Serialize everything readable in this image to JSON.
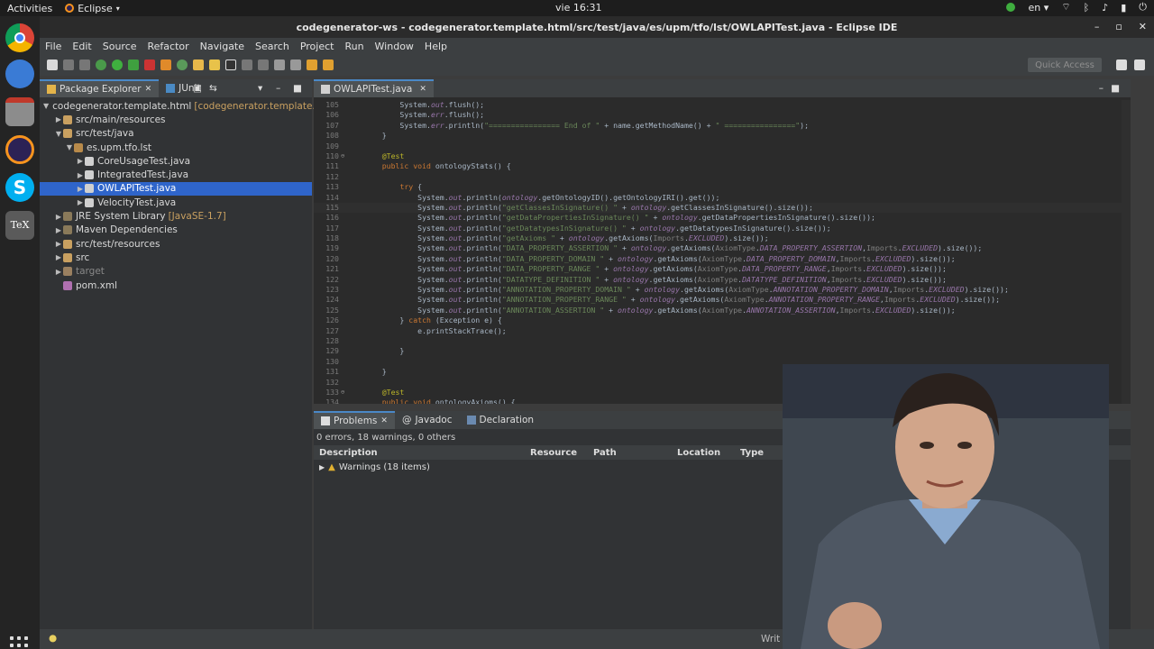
{
  "topbar": {
    "activities": "Activities",
    "app": "Eclipse",
    "clock": "vie 16:31",
    "lang": "en"
  },
  "titlebar": {
    "title": "codegenerator-ws - codegenerator.template.html/src/test/java/es/upm/tfo/lst/OWLAPITest.java - Eclipse IDE"
  },
  "menu": [
    "File",
    "Edit",
    "Source",
    "Refactor",
    "Navigate",
    "Search",
    "Project",
    "Run",
    "Window",
    "Help"
  ],
  "toolbar": {
    "quick_access": "Quick Access"
  },
  "package_explorer": {
    "tab_label": "Package Explorer",
    "junit_label": "JUnit",
    "items": [
      {
        "label": "codegenerator.template.html",
        "deco": "[codegenerator.template.html",
        "indent": 0
      },
      {
        "label": "src/main/resources",
        "indent": 1
      },
      {
        "label": "src/test/java",
        "indent": 1
      },
      {
        "label": "es.upm.tfo.lst",
        "indent": 2
      },
      {
        "label": "CoreUsageTest.java",
        "indent": 3
      },
      {
        "label": "IntegratedTest.java",
        "indent": 3
      },
      {
        "label": "OWLAPITest.java",
        "indent": 3,
        "selected": true
      },
      {
        "label": "VelocityTest.java",
        "indent": 3
      },
      {
        "label": "JRE System Library",
        "deco": "[JavaSE-1.7]",
        "indent": 1
      },
      {
        "label": "Maven Dependencies",
        "indent": 1
      },
      {
        "label": "src/test/resources",
        "indent": 1
      },
      {
        "label": "src",
        "indent": 1
      },
      {
        "label": "target",
        "indent": 1,
        "dim": true
      },
      {
        "label": "pom.xml",
        "indent": 1
      }
    ]
  },
  "editor": {
    "tab_label": "OWLAPITest.java",
    "lines": [
      {
        "n": "105",
        "code": "        System.out.flush();"
      },
      {
        "n": "106",
        "code": "        System.err.flush();"
      },
      {
        "n": "107",
        "code": "        System.err.println(\"================ End of \" + name.getMethodName() + \" ================\");"
      },
      {
        "n": "108",
        "code": "    }"
      },
      {
        "n": "109",
        "code": ""
      },
      {
        "n": "110",
        "code": "    @Test"
      },
      {
        "n": "111",
        "code": "    public void ontologyStats() {"
      },
      {
        "n": "112",
        "code": ""
      },
      {
        "n": "113",
        "code": "        try {"
      },
      {
        "n": "114",
        "code": "            System.out.println(ontology.getOntologyID().getOntologyIRI().get());"
      },
      {
        "n": "115",
        "code": "            System.out.println(\"getClassesInSignature() \" + ontology.getClassesInSignature().size());"
      },
      {
        "n": "116",
        "code": "            System.out.println(\"getDataPropertiesInSignature() \" + ontology.getDataPropertiesInSignature().size());"
      },
      {
        "n": "117",
        "code": "            System.out.println(\"getDatatypesInSignature() \" + ontology.getDatatypesInSignature().size());"
      },
      {
        "n": "118",
        "code": "            System.out.println(\"getAxioms \" + ontology.getAxioms(Imports.EXCLUDED).size());"
      },
      {
        "n": "119",
        "code": "            System.out.println(\"DATA_PROPERTY_ASSERTION \" + ontology.getAxioms(AxiomType.DATA_PROPERTY_ASSERTION,Imports.EXCLUDED).size());"
      },
      {
        "n": "120",
        "code": "            System.out.println(\"DATA_PROPERTY_DOMAIN \" + ontology.getAxioms(AxiomType.DATA_PROPERTY_DOMAIN,Imports.EXCLUDED).size());"
      },
      {
        "n": "121",
        "code": "            System.out.println(\"DATA_PROPERTY_RANGE \" + ontology.getAxioms(AxiomType.DATA_PROPERTY_RANGE,Imports.EXCLUDED).size());"
      },
      {
        "n": "122",
        "code": "            System.out.println(\"DATATYPE_DEFINITION \" + ontology.getAxioms(AxiomType.DATATYPE_DEFINITION,Imports.EXCLUDED).size());"
      },
      {
        "n": "123",
        "code": "            System.out.println(\"ANNOTATION_PROPERTY_DOMAIN \" + ontology.getAxioms(AxiomType.ANNOTATION_PROPERTY_DOMAIN,Imports.EXCLUDED).size());"
      },
      {
        "n": "124",
        "code": "            System.out.println(\"ANNOTATION_PROPERTY_RANGE \" + ontology.getAxioms(AxiomType.ANNOTATION_PROPERTY_RANGE,Imports.EXCLUDED).size());"
      },
      {
        "n": "125",
        "code": "            System.out.println(\"ANNOTATION_ASSERTION \" + ontology.getAxioms(AxiomType.ANNOTATION_ASSERTION,Imports.EXCLUDED).size());"
      },
      {
        "n": "126",
        "code": "        } catch (Exception e) {"
      },
      {
        "n": "127",
        "code": "            e.printStackTrace();"
      },
      {
        "n": "128",
        "code": ""
      },
      {
        "n": "129",
        "code": "        }"
      },
      {
        "n": "130",
        "code": ""
      },
      {
        "n": "131",
        "code": "    }"
      },
      {
        "n": "132",
        "code": ""
      },
      {
        "n": "133",
        "code": "    @Test"
      },
      {
        "n": "134",
        "code": "    public void ontologyAxioms() {"
      }
    ]
  },
  "problems": {
    "tabs": [
      "Problems",
      "Javadoc",
      "Declaration"
    ],
    "summary": "0 errors, 18 warnings, 0 others",
    "columns": [
      "Description",
      "Resource",
      "Path",
      "Location",
      "Type"
    ],
    "rows": [
      {
        "description": "Warnings (18 items)"
      }
    ]
  },
  "statusbar": {
    "text": "Writ"
  }
}
